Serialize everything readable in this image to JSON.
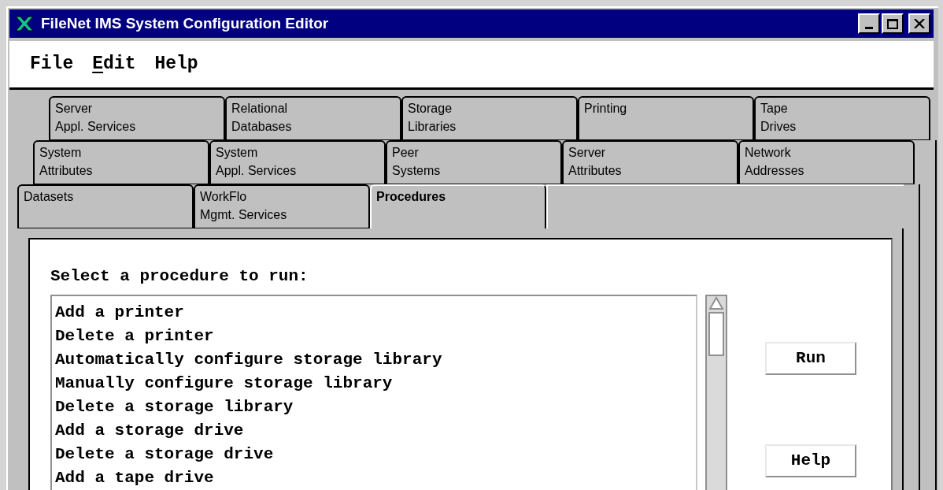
{
  "window": {
    "title": "FileNet IMS System Configuration Editor"
  },
  "menu": [
    {
      "label": "File",
      "mnemonic": false
    },
    {
      "label": "Edit",
      "mnemonic": true
    },
    {
      "label": "Help",
      "mnemonic": false
    }
  ],
  "tab_rows": [
    [
      {
        "label": "Server\nAppl. Services",
        "selected": false
      },
      {
        "label": "Relational\nDatabases",
        "selected": false
      },
      {
        "label": "Storage\nLibraries",
        "selected": false
      },
      {
        "label": "Printing",
        "selected": false
      },
      {
        "label": "Tape\nDrives",
        "selected": false
      }
    ],
    [
      {
        "label": "System\nAttributes",
        "selected": false
      },
      {
        "label": "System\nAppl. Services",
        "selected": false
      },
      {
        "label": "Peer\nSystems",
        "selected": false
      },
      {
        "label": "Server\nAttributes",
        "selected": false
      },
      {
        "label": "Network\nAddresses",
        "selected": false
      }
    ],
    [
      {
        "label": "Datasets",
        "selected": false
      },
      {
        "label": "WorkFlo\nMgmt. Services",
        "selected": false
      },
      {
        "label": "Procedures",
        "selected": true
      }
    ]
  ],
  "procedures": {
    "prompt": "Select a procedure to run:",
    "items": [
      "Add a printer",
      "Delete a printer",
      "Automatically configure storage library",
      "Manually configure storage library",
      "Delete a storage library",
      "Add a storage drive",
      "Delete a storage drive",
      "Add a tape drive"
    ],
    "buttons": [
      "Run",
      "Help"
    ]
  }
}
